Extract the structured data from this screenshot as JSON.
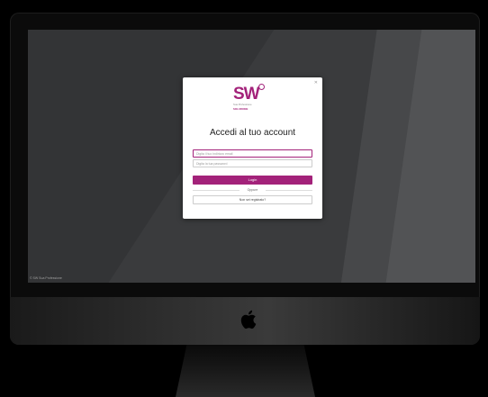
{
  "dialog": {
    "close_icon": "✕",
    "logo": {
      "mark": "SW",
      "tagline": "Sua Professione",
      "tagline2": "SOLUZIONE"
    },
    "title": "Accedi al tuo account",
    "username_placeholder": "Digita il tuo indirizzo email",
    "password_placeholder": "Digita la tua password",
    "login_label": "Login",
    "or_label": "Oppure",
    "register_label": "Non sei registrato?"
  },
  "screen": {
    "footer_text": "© SW Sua Professione"
  },
  "colors": {
    "accent": "#a3227a",
    "screen_bg": "#3a3b3d"
  }
}
